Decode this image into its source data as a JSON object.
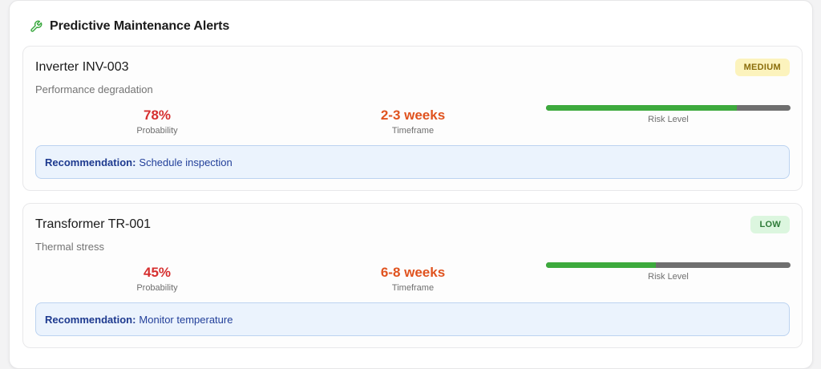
{
  "header": {
    "title": "Predictive Maintenance Alerts",
    "icon": "wrench-icon",
    "icon_color": "#3aa83f"
  },
  "alerts": [
    {
      "title": "Inverter INV-003",
      "severity": "MEDIUM",
      "description": "Performance degradation",
      "probability": "78%",
      "probability_label": "Probability",
      "timeframe": "2-3 weeks",
      "timeframe_label": "Timeframe",
      "risk_level": 0.78,
      "risk_label": "Risk Level",
      "recommendation_label": "Recommendation:",
      "recommendation": "Schedule inspection"
    },
    {
      "title": "Transformer TR-001",
      "severity": "LOW",
      "description": "Thermal stress",
      "probability": "45%",
      "probability_label": "Probability",
      "timeframe": "6-8 weeks",
      "timeframe_label": "Timeframe",
      "risk_level": 0.45,
      "risk_label": "Risk Level",
      "recommendation_label": "Recommendation:",
      "recommendation": "Monitor temperature"
    }
  ],
  "colors": {
    "probability": "#d62f2f",
    "timeframe": "#e0531f",
    "risk_fill": "#3daa3d",
    "risk_track": "#6f6f6f",
    "badge_medium_bg": "#fcf3bd",
    "badge_low_bg": "#dcf6df"
  }
}
